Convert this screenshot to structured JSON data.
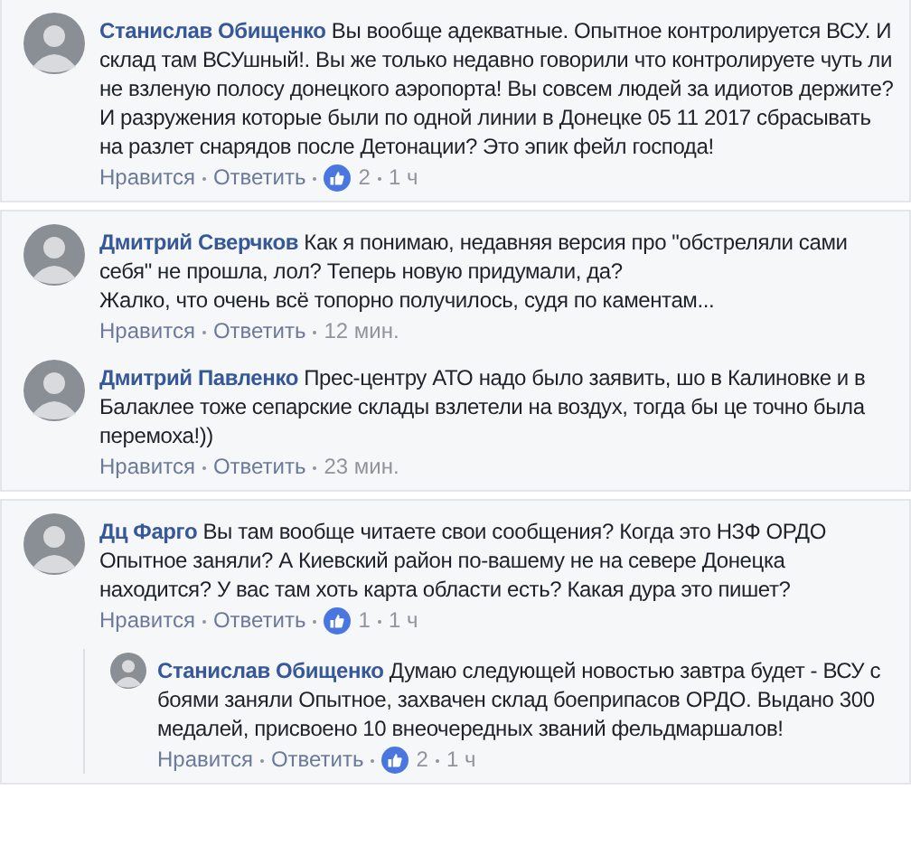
{
  "threads": [
    {
      "comments": [
        {
          "author": "Станислав Обищенко",
          "text": "Вы вообще адекватные. Опытное контролируется ВСУ. И склад там ВСУшный!. Вы же только недавно говорили что контролируете чуть ли не взленую полосу донецкого аэропорта! Вы совсем людей за идиотов держите? И разружения которые были по одной линии в Донецке 05 11 2017 сбрасывать на разлет снарядов после Детонации? Это эпик фейл господа!",
          "like": "Нравится",
          "reply": "Ответить",
          "likes": "2",
          "time": "1 ч"
        }
      ]
    },
    {
      "comments": [
        {
          "author": "Дмитрий Сверчков",
          "text": "Как я понимаю, недавняя версия про \"обстреляли сами себя\" не прошла, лол? Теперь новую придумали, да?\nЖалко, что очень всё топорно получилось, судя по каментам...",
          "like": "Нравится",
          "reply": "Ответить",
          "time": "12 мин."
        },
        {
          "author": "Дмитрий Павленко",
          "text": "Прес-центру АТО надо было заявить, шо в Калиновке и в Балаклее тоже сепарские склады взлетели на воздух, тогда бы це точно была перемоха!))",
          "like": "Нравится",
          "reply": "Ответить",
          "time": "23 мин."
        }
      ]
    },
    {
      "comments": [
        {
          "author": "Дц Фарго",
          "text": "Вы там вообще читаете свои сообщения? Когда это НЗФ ОРДО Опытное заняли? А Киевский район по-вашему не на севере Донецка находится? У вас там хоть карта области есть? Какая дура это пишет?",
          "like": "Нравится",
          "reply": "Ответить",
          "likes": "1",
          "time": "1 ч",
          "replies": [
            {
              "author": "Станислав Обищенко",
              "text": "Думаю следующей новостью завтра будет - ВСУ с боями заняли Опытное, захвачен склад боеприпасов ОРДО. Выдано 300 медалей, присвоено 10 внеочередных званий фельдмаршалов!",
              "like": "Нравится",
              "reply": "Ответить",
              "likes": "2",
              "time": "1 ч"
            }
          ]
        }
      ]
    }
  ]
}
